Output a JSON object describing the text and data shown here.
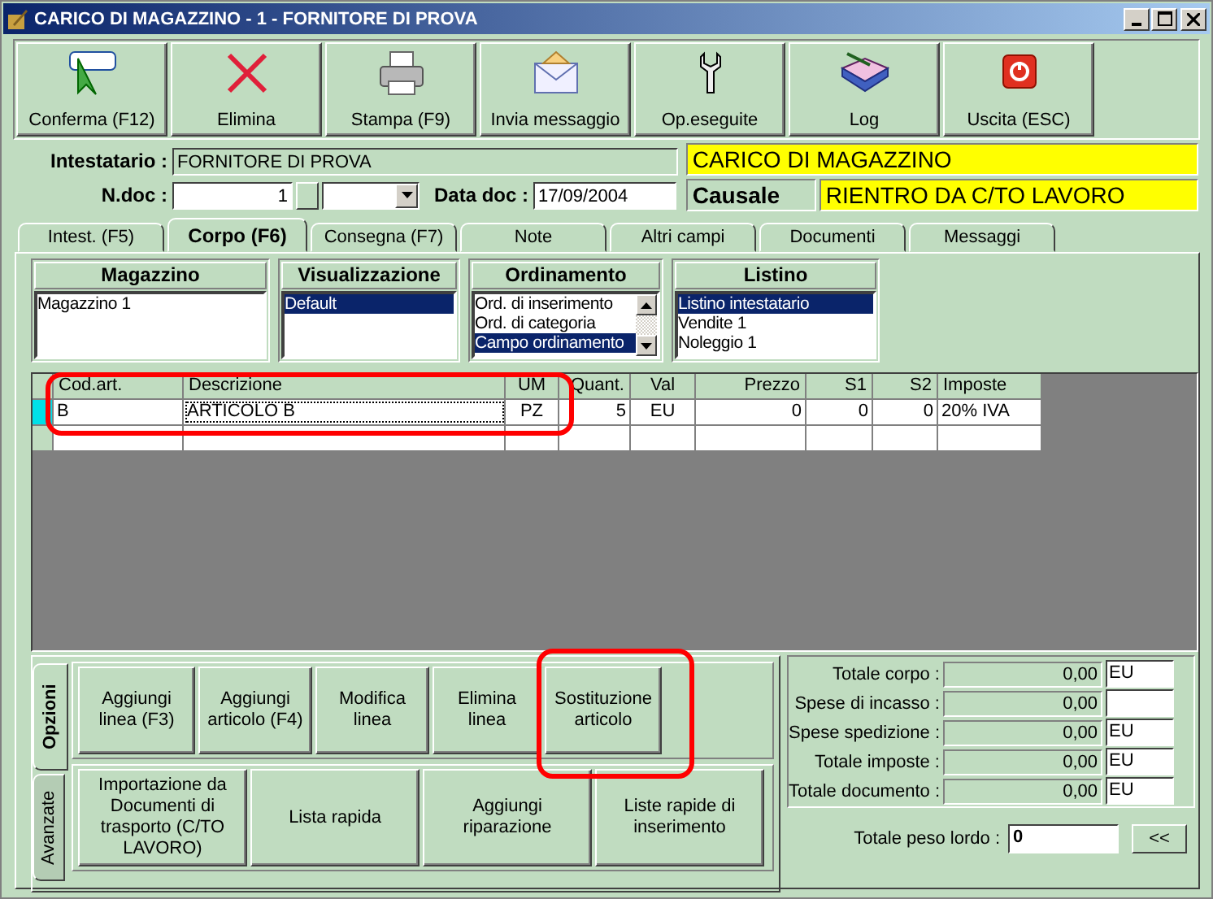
{
  "window": {
    "title": "CARICO DI MAGAZZINO - 1  - FORNITORE DI PROVA"
  },
  "toolbar": [
    {
      "label": "Conferma (F12)"
    },
    {
      "label": "Elimina"
    },
    {
      "label": "Stampa (F9)"
    },
    {
      "label": "Invia messaggio"
    },
    {
      "label": "Op.eseguite"
    },
    {
      "label": "Log"
    },
    {
      "label": "Uscita (ESC)"
    }
  ],
  "header": {
    "intestatario": {
      "label": "Intestatario :",
      "value": "FORNITORE DI PROVA"
    },
    "ndoc": {
      "label": "N.doc :",
      "value": "1"
    },
    "data_doc": {
      "label": "Data doc :",
      "value": "17/09/2004"
    },
    "banner": "CARICO DI MAGAZZINO",
    "causale": {
      "label": "Causale",
      "value": "RIENTRO DA C/TO LAVORO"
    }
  },
  "tabs": [
    {
      "label": "Intest. (F5)",
      "selected": false
    },
    {
      "label": "Corpo (F6)",
      "selected": true
    },
    {
      "label": "Consegna (F7)",
      "selected": false
    },
    {
      "label": "Note",
      "selected": false
    },
    {
      "label": "Altri campi",
      "selected": false
    },
    {
      "label": "Documenti",
      "selected": false
    },
    {
      "label": "Messaggi",
      "selected": false
    }
  ],
  "lists": [
    {
      "title": "Magazzino",
      "items": [
        {
          "label": "Magazzino 1",
          "selected": false
        }
      ]
    },
    {
      "title": "Visualizzazione",
      "items": [
        {
          "label": "Default",
          "selected": true
        }
      ]
    },
    {
      "title": "Ordinamento",
      "items": [
        {
          "label": "Ord. di inserimento",
          "selected": false
        },
        {
          "label": "Ord. di categoria",
          "selected": false
        },
        {
          "label": "Campo ordinamento",
          "selected": true
        }
      ],
      "scrollbar": true
    },
    {
      "title": "Listino",
      "items": [
        {
          "label": "Listino intestatario",
          "selected": true
        },
        {
          "label": "Vendite 1",
          "selected": false
        },
        {
          "label": "Noleggio 1",
          "selected": false
        }
      ]
    }
  ],
  "table": {
    "columns": [
      "Cod.art.",
      "Descrizione",
      "UM",
      "Quant.",
      "Val",
      "Prezzo",
      "S1",
      "S2",
      "Imposte"
    ],
    "rows": [
      {
        "selected": true,
        "cells": [
          "B",
          "ARTICOLO B",
          "PZ",
          "5",
          "EU",
          "0",
          "0",
          "0",
          "20% IVA"
        ]
      }
    ]
  },
  "side_tabs": [
    {
      "label": "Opzioni",
      "selected": true
    },
    {
      "label": "Avanzate",
      "selected": false
    }
  ],
  "options": [
    {
      "label": "Aggiungi linea (F3)"
    },
    {
      "label": "Aggiungi articolo (F4)"
    },
    {
      "label": "Modifica linea"
    },
    {
      "label": "Elimina linea"
    },
    {
      "label": "Sostituzione articolo"
    }
  ],
  "advanced": [
    {
      "label": "Importazione da Documenti di trasporto (C/TO LAVORO)"
    },
    {
      "label": "Lista rapida"
    },
    {
      "label": "Aggiungi riparazione"
    },
    {
      "label": "Liste rapide di inserimento"
    }
  ],
  "totals": [
    {
      "label": "Totale corpo :",
      "value": "0,00",
      "currency": "EU"
    },
    {
      "label": "Spese di incasso :",
      "value": "0,00"
    },
    {
      "label": "Spese spedizione :",
      "value": "0,00",
      "currency": "EU"
    },
    {
      "label": "Totale imposte :",
      "value": "0,00",
      "currency": "EU"
    },
    {
      "label": "Totale documento :",
      "value": "0,00",
      "currency": "EU"
    }
  ],
  "peso": {
    "label": "Totale peso lordo :",
    "value": "0",
    "button": "<<"
  }
}
